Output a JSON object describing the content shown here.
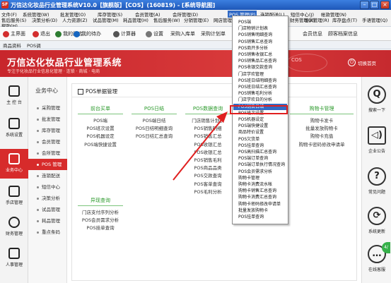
{
  "window": {
    "app_icon": "SF",
    "title": "万信达化妆品行业管理系统V10.0【旗舰版】【COS】(160819) - [系统导航图]"
  },
  "menubar": {
    "row1": [
      "文件(F)",
      "系统管理(W)",
      "批发管理(O)",
      "库存管理(S)",
      "会员管理(A)",
      "会所管理(D)",
      "POS 管理(P)",
      "连锁配送(L)",
      "短信中心(J)",
      "帐款管理(N)"
    ],
    "row2": [
      "售后服务(S)",
      "决策分析(D)",
      "人力资源(Z)",
      "试品管理(M)",
      "耗品管理(H)",
      "售后服务(W)",
      "分销管理(E)",
      "网店管理(I)",
      "财务管理(K)",
      "培训管理(R)",
      "库存盘点(T)",
      "手语管理(Q)"
    ],
    "row3": [
      "帮助(H)"
    ]
  },
  "toolbar": {
    "buttons": [
      {
        "label": "主界面",
        "icon": "home-icon",
        "color": "#d32f2f"
      },
      {
        "label": "退出",
        "icon": "exit-icon",
        "color": "#d32f2f"
      },
      {
        "label": "我的门店",
        "icon": "store-icon",
        "color": "#2e7d32"
      },
      {
        "label": "我的待办",
        "icon": "pending-icon",
        "color": "#1565c0"
      },
      {
        "label": "计算器",
        "icon": "calculator-icon",
        "color": "#555555"
      },
      {
        "label": "设置",
        "icon": "gear-icon",
        "color": "#555555"
      },
      {
        "label": "采购入库单",
        "icon": "purchase-icon",
        "color": "#555555"
      },
      {
        "label": "采购计划单",
        "icon": "plan-icon",
        "color": "#555555"
      },
      {
        "label": "会员信息",
        "icon": "member-icon",
        "color": "#555555"
      },
      {
        "label": "顾客档案信息",
        "icon": "customer-icon",
        "color": "#555555"
      }
    ],
    "tabs": [
      "商品资料",
      "POS调"
    ]
  },
  "banner": {
    "brand": "万信达化妆品行业管理系统",
    "slogan": "专注于化妆品行业信息化管理 · 连锁 · 商城 · 电商",
    "badge": "COS",
    "switch_label": "切换首页"
  },
  "left_sidebar": {
    "items": [
      {
        "label": "主 控 台",
        "icon": "home-icon",
        "active": false
      },
      {
        "label": "系统设置",
        "icon": "settings-icon",
        "active": false
      },
      {
        "label": "业务中心",
        "icon": "business-icon",
        "active": true
      },
      {
        "label": "手店管理",
        "icon": "phone-icon",
        "active": false
      },
      {
        "label": "财务管理",
        "icon": "finance-icon",
        "active": false
      },
      {
        "label": "人事管理",
        "icon": "staff-icon",
        "active": false
      }
    ]
  },
  "subnav": {
    "heading": "业务中心",
    "items": [
      "采购管理",
      "批发管理",
      "库存管理",
      "会员管理",
      "会所管理",
      "POS 管理",
      "连锁配送",
      "短信中心",
      "决策分析",
      "试品管理",
      "耗品管理",
      "重点条码"
    ],
    "active_index": 5
  },
  "panel": {
    "title": "POS单据管理",
    "groups": [
      {
        "heading": "前台买单",
        "items": [
          "POS端",
          "POS班次设置",
          "POS机器设定",
          "POS端快捷设置"
        ]
      },
      {
        "heading": "POS日结",
        "items": [
          "POS端日结",
          "POS日结明细查询",
          "POS日结汇总查询"
        ]
      },
      {
        "heading": "POS数据查询",
        "items": [
          "门店销售计划表",
          "POS销售明细",
          "POS销售汇总",
          "POS收银汇总",
          "POS收银汇总",
          "POS销售毛利",
          "POS商品品类",
          "POS交款查询",
          "POS客单查询",
          "POS毛利分析"
        ]
      },
      {
        "heading": "购物卡管理",
        "items": [
          "购物卡发卡",
          "批量发放购物卡",
          "购物卡充值",
          "购物卡密码修改申请单"
        ]
      },
      {
        "heading": "异现查询",
        "items": [
          "门店支付序列分析",
          "POS会员需求分析",
          "POS挂单查询"
        ]
      }
    ]
  },
  "right_sidebar": {
    "buttons": [
      {
        "label": "搜索一下",
        "icon": "search-icon",
        "glyph": "Q"
      },
      {
        "label": "企业公告",
        "icon": "speaker-icon",
        "glyph": "◁)"
      },
      {
        "label": "常见问题",
        "icon": "help-icon",
        "glyph": "?"
      },
      {
        "label": "系统更新",
        "icon": "update-icon",
        "glyph": "⟳"
      },
      {
        "label": "在线客服",
        "icon": "service-icon",
        "glyph": "…"
      }
    ],
    "badge": "4/"
  },
  "dropdown": {
    "items": [
      "POS端",
      "门店物销计划表",
      "POS销售明细查询",
      "POS销售汇总查询",
      "POS商开多分析",
      "POS销售收银汇总",
      "POS销售品汇总查询",
      "POS收银交款查询",
      "门店学欢管理",
      "POS班日结明细查询",
      "POS班日结汇总查询",
      "POS销售毛利分析",
      "门店学欢日的分析",
      "POS销售日结",
      "POS班次设置",
      "POS机器设定",
      "POS端快捷设置",
      "商品特价设置",
      "POS欠货单",
      "POS挂单查询",
      "POS高扫描汇总查询",
      "POS端订单查询",
      "POS端订单执行情况查询",
      "POS会员需求分析",
      "购物卡管理",
      "购物卡消费流水帐",
      "购物卡销售汇总查询",
      "购物卡消费汇总查询",
      "购物卡密码修改申请单",
      "批量发放购物卡",
      "POS挂单查询"
    ],
    "highlighted_index": 13
  }
}
